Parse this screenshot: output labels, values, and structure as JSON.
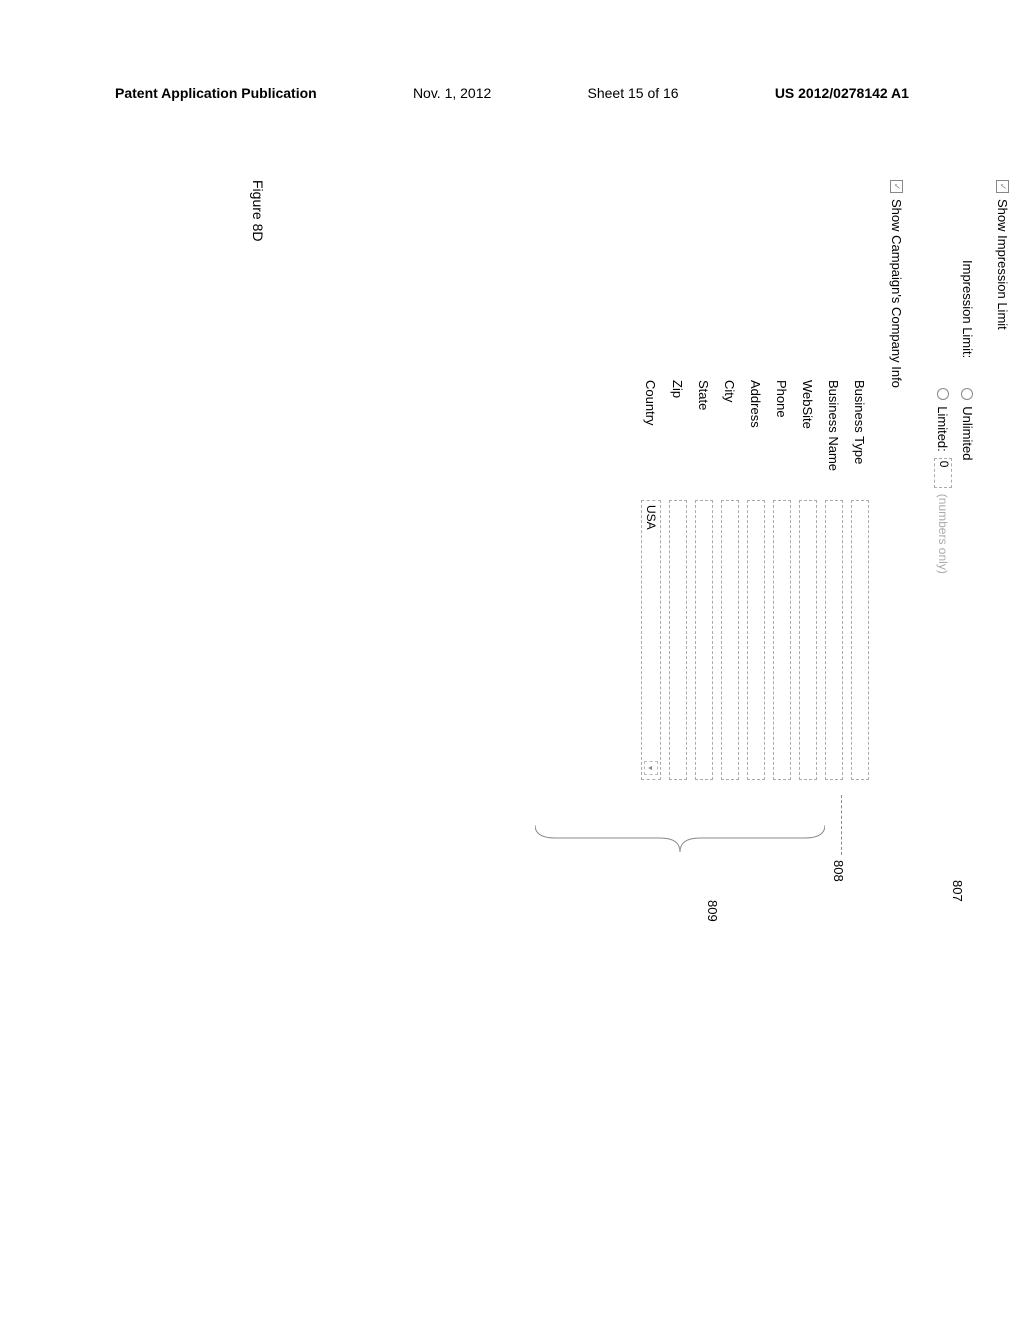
{
  "header": {
    "publication_type": "Patent Application Publication",
    "date": "Nov. 1, 2012",
    "sheet": "Sheet 15 of 16",
    "publication_number": "US 2012/0278142 A1"
  },
  "form": {
    "show_impression_limit": {
      "label": "Show Impression Limit",
      "checked": true
    },
    "impression_limit": {
      "label": "Impression Limit:",
      "options": {
        "unlimited": "Unlimited",
        "limited": "Limited:"
      },
      "limited_value": "0",
      "hint": "(numbers only)"
    },
    "show_company_info": {
      "label": "Show Campaign's Company Info",
      "checked": true
    },
    "fields": [
      {
        "label": "Business Type",
        "type": "text",
        "value": ""
      },
      {
        "label": "Business Name",
        "type": "text",
        "value": ""
      },
      {
        "label": "WebSite",
        "type": "text",
        "value": ""
      },
      {
        "label": "Phone",
        "type": "text",
        "value": ""
      },
      {
        "label": "Address",
        "type": "text",
        "value": ""
      },
      {
        "label": "City",
        "type": "text",
        "value": ""
      },
      {
        "label": "State",
        "type": "text",
        "value": ""
      },
      {
        "label": "Zip",
        "type": "text",
        "value": ""
      },
      {
        "label": "Country",
        "type": "select",
        "value": "USA"
      }
    ]
  },
  "callouts": {
    "impression_group": "807",
    "business_type": "808",
    "fields_group": "809"
  },
  "figure_label": "Figure 8D"
}
